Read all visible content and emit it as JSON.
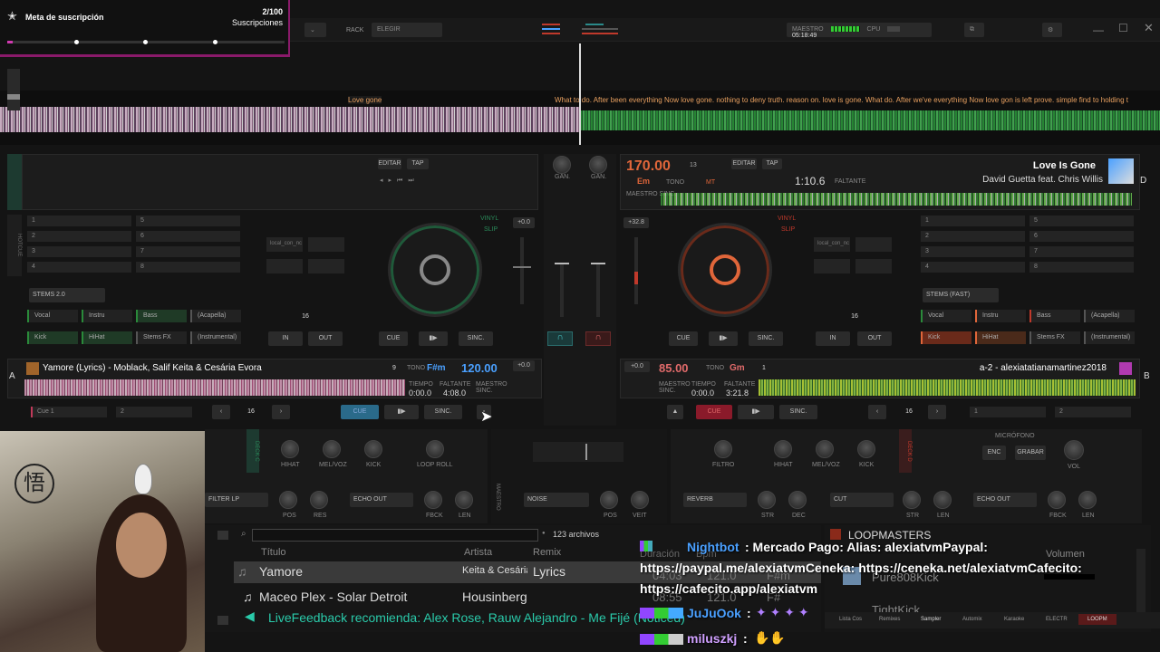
{
  "goal": {
    "title": "Meta de suscripción",
    "count": "2/100",
    "unit": "Suscripciones"
  },
  "topbar": {
    "rack_label": "RACK",
    "rack_value": "ELEGIR",
    "master_label": "MAESTRO",
    "cpu_label": "CPU",
    "time": "05:18:49"
  },
  "overview": {
    "lyrics_left": "Love gone",
    "lyrics_right": "What to do. After been everything Now love gone. nothing to deny truth. reason on. love is gone. What do. After we've everything Now love gon    is left prove. simple find to holding t"
  },
  "deckD": {
    "bpm": "170.00",
    "key": "Em",
    "pitch": "13",
    "tono": "TONO",
    "mt": "MT",
    "title": "Love Is Gone",
    "artist": "David Guetta feat. Chris Willis",
    "remaining": "1:10.6",
    "remaining_label": "FALTANTE",
    "letter": "D",
    "pitch_value": "+32.8",
    "editar": "EDITAR",
    "tap": "TAP",
    "master_sync": "MAESTRO SINC.",
    "stems_label": "STEMS (FAST)",
    "pads": [
      "Vocal",
      "Instru",
      "Bass",
      "(Acapella)",
      "Kick",
      "HiHat",
      "Stems FX",
      "(Instrumental)"
    ],
    "loop_value": "16",
    "in": "IN",
    "out": "OUT",
    "cue": "CUE",
    "sync": "SINC."
  },
  "deckC": {
    "stems_label": "STEMS 2.0",
    "pads": [
      "Vocal",
      "Instru",
      "Bass",
      "(Acapella)",
      "Kick",
      "HiHat",
      "Stems FX",
      "(Instrumental)"
    ],
    "loop_value": "16",
    "in": "IN",
    "out": "OUT",
    "cue": "CUE",
    "sync": "SINC.",
    "pitch_value": "+0.0",
    "editar": "EDITAR",
    "tap": "TAP",
    "hotcues": [
      "1",
      "5",
      "2",
      "6",
      "3",
      "7",
      "4",
      "8"
    ]
  },
  "mixer": {
    "gain": "GAN.",
    "vinyl": "VINYL",
    "slip": "SLIP"
  },
  "deckA": {
    "letter": "A",
    "title": "Yamore (Lyrics)",
    "artist": "Moblack, Salif Keita & Cesária Evora",
    "bpm": "120.00",
    "key": "F#m",
    "tono": "TONO",
    "keynum": "9",
    "tiempo_label": "TIEMPO",
    "tiempo": "0:00.0",
    "faltante_label": "FALTANTE",
    "faltante": "4:08.0",
    "master": "MAESTRO SINC.",
    "pitch": "+0.0",
    "loop": "16",
    "cue": "CUE",
    "sync": "SINC.",
    "cue1": "Cue 1",
    "cue2": "2"
  },
  "deckB": {
    "letter": "B",
    "bpm": "85.00",
    "key": "Gm",
    "tono": "TONO",
    "keynum": "1",
    "title": "a-2 - alexiatatianamartinez2018",
    "tiempo_label": "TIEMPO",
    "tiempo": "0:00.0",
    "faltante_label": "FALTANTE",
    "faltante": "3:21.8",
    "master": "MAESTRO SINC.",
    "pitch": "+0.0",
    "loop": "16",
    "cue": "CUE",
    "sync": "SINC.",
    "cue1": "1",
    "cue2": "2"
  },
  "fx_left": {
    "hihat": "HIHAT",
    "melvoz": "MEL/VOZ",
    "kick": "KICK",
    "loop_roll": "LOOP ROLL",
    "filter": "FILTER LP",
    "echo": "ECHO OUT",
    "pos": "POS",
    "res": "RES",
    "fbck": "FBCK",
    "len": "LEN",
    "deck": "DECK C"
  },
  "fx_center": {
    "noise": "NOISE",
    "pos": "POS",
    "veit": "VEIT",
    "maestro": "MAESTRO"
  },
  "fx_right": {
    "filtro": "FILTRO",
    "hihat": "HIHAT",
    "melvoz": "MEL/VOZ",
    "kick": "KICK",
    "reverb": "REVERB",
    "cut": "CUT",
    "echo": "ECHO OUT",
    "str": "STR",
    "dec": "DEC",
    "str2": "STR",
    "len": "LEN",
    "fbck": "FBCK",
    "len2": "LEN",
    "deck": "DECK D",
    "mic": "MICRÓFONO",
    "enc": "ENC",
    "grabar": "GRABAR",
    "vol": "VOL"
  },
  "library": {
    "count": "123 archivos",
    "headers": {
      "title": "Título",
      "artist": "Artista",
      "remix": "Remix"
    },
    "rows": [
      {
        "title": "Yamore",
        "artist": "Keita & Cesária E",
        "remix": "Lyrics"
      },
      {
        "title": "Maceo Plex - Solar Detroit",
        "artist": "Housinberg",
        "remix": ""
      }
    ],
    "live_feedback": "LiveFeedback recomienda: Alex Rose, Rauw Alejandro - Me Fijé (Noticed)"
  },
  "sampler": {
    "title": "LOOPMASTERS",
    "volume_label": "Volumen",
    "items": [
      "Pure808Kick",
      "TightKick"
    ],
    "ghost": {
      "duration": "Duración",
      "bpm": "Bpm",
      "time": "04:03",
      "val": "121.0",
      "key": "F#m",
      "time2": "08:55",
      "val2": "121.0",
      "key2": "F#"
    },
    "tabs": [
      "Lista Cos",
      "Remixes",
      "Sampler",
      "Automix",
      "Karaoke",
      "ELECTR",
      "LOOPM"
    ]
  },
  "chat": [
    {
      "user": "Nightbot",
      "text": ": Mercado Pago: Alias: alexiatvmPaypal:"
    },
    {
      "user": "",
      "text": "https://paypal.me/alexiatvmCeneka: https://ceneka.net/alexiatvmCafecito:"
    },
    {
      "user": "",
      "text": "https://cafecito.app/alexiatvm"
    },
    {
      "user": "JuJuOok",
      "text": ":"
    },
    {
      "user": "miluszkj",
      "text": ":"
    }
  ],
  "colors": {
    "green": "#2a8a3a",
    "red": "#c0392b",
    "orange": "#e0663a",
    "accent_blue": "#4aa0ff"
  }
}
